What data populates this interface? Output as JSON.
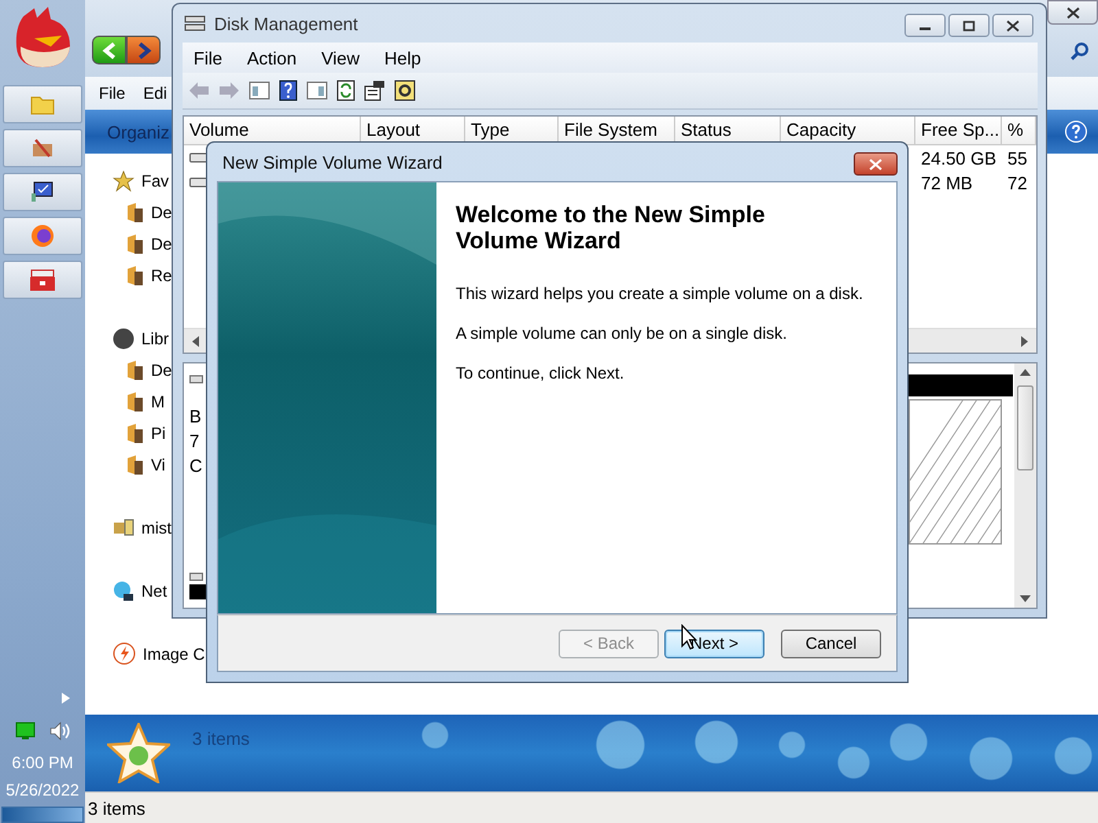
{
  "taskbar": {
    "buttons": [
      {
        "kind": "folder"
      },
      {
        "kind": "tools"
      },
      {
        "kind": "monitor"
      },
      {
        "kind": "browser"
      },
      {
        "kind": "toolbox"
      }
    ],
    "clock": {
      "time": "6:00 PM",
      "date": "5/26/2022"
    }
  },
  "explorer": {
    "menu": [
      "File",
      "Edi"
    ],
    "toolbar": [
      "Organiz"
    ],
    "nav": [
      {
        "label": "Fav",
        "kind": "star",
        "children": [
          {
            "label": "De",
            "kind": "folder"
          },
          {
            "label": "De",
            "kind": "folder"
          },
          {
            "label": "Re",
            "kind": "folder"
          }
        ]
      },
      {
        "label": "Libr",
        "kind": "library",
        "children": [
          {
            "label": "De",
            "kind": "folder"
          },
          {
            "label": "M",
            "kind": "folder"
          },
          {
            "label": "Pi",
            "kind": "folder"
          },
          {
            "label": "Vi",
            "kind": "folder"
          }
        ]
      },
      {
        "label": "mist",
        "kind": "computer"
      },
      {
        "label": "Net",
        "kind": "network"
      },
      {
        "label": "Image C",
        "kind": "bolt"
      }
    ],
    "details": {
      "count": "3 items"
    },
    "status_bar": "3 items"
  },
  "disk_management": {
    "title": "Disk Management",
    "menu": [
      "File",
      "Action",
      "View",
      "Help"
    ],
    "columns": [
      "Volume",
      "Layout",
      "Type",
      "File System",
      "Status",
      "Capacity",
      "Free Sp...",
      "%"
    ],
    "rows": [
      {
        "free_space": "24.50 GB",
        "percent": "55"
      },
      {
        "free_space": "72 MB",
        "percent": "72"
      }
    ],
    "disk_labels": [
      "B",
      "7",
      "C"
    ]
  },
  "wizard": {
    "title": "New Simple Volume Wizard",
    "heading": "Welcome to the New Simple Volume Wizard",
    "paragraphs": [
      "This wizard helps you create a simple volume on a disk.",
      "A simple volume can only be on a single disk.",
      "To continue, click Next."
    ],
    "buttons": [
      {
        "label": "< Back",
        "disabled": true,
        "default": false
      },
      {
        "label": "Next >",
        "disabled": false,
        "default": true
      },
      {
        "label": "Cancel",
        "disabled": false,
        "default": false
      }
    ]
  }
}
